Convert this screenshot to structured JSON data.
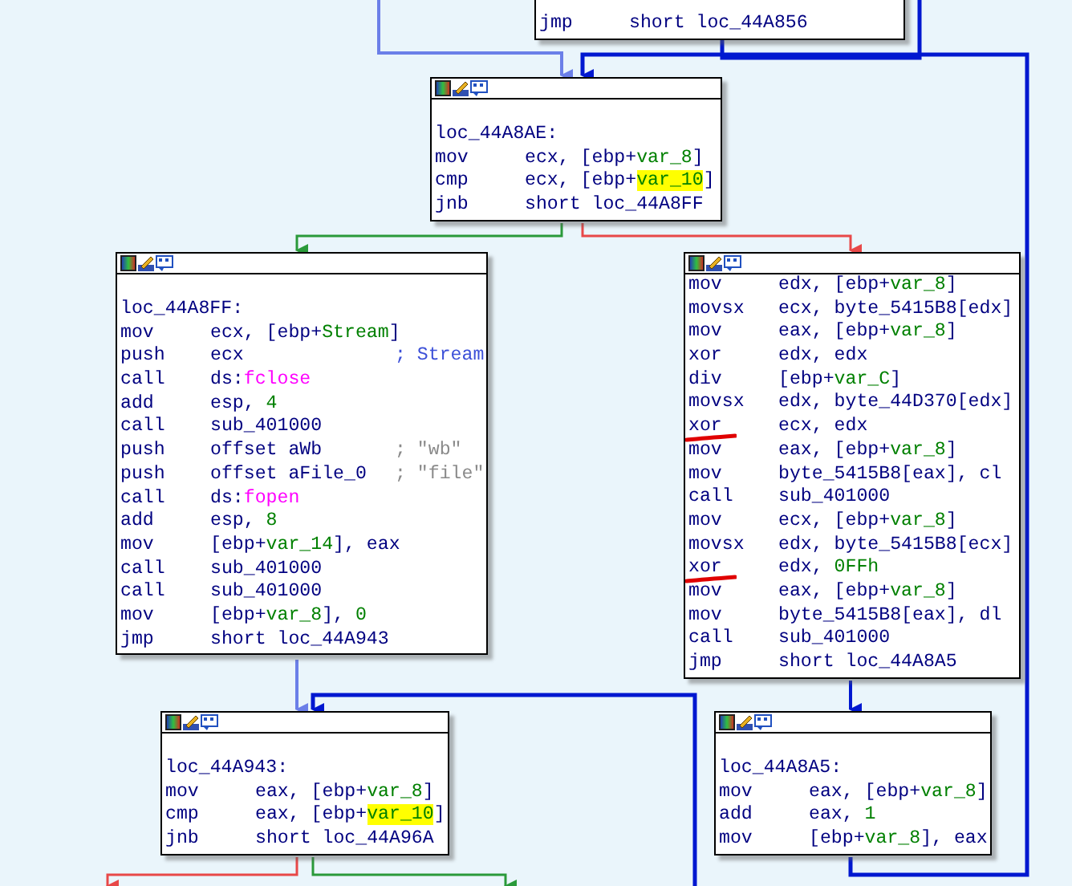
{
  "nodes": [
    {
      "header": false,
      "lines": [
        {
          "kind": "instr",
          "mnemonic": "jmp",
          "operands": [
            {
              "text": "short loc_44A856",
              "kind": "plain"
            }
          ]
        }
      ]
    },
    {
      "header": true,
      "lines": [
        {
          "kind": "label",
          "text": "loc_44A8AE:"
        },
        {
          "kind": "instr",
          "mnemonic": "mov",
          "operands": [
            {
              "text": "ecx, [ebp+",
              "kind": "plain"
            },
            {
              "text": "var_8",
              "kind": "name"
            },
            {
              "text": "]",
              "kind": "plain"
            }
          ]
        },
        {
          "kind": "instr",
          "mnemonic": "cmp",
          "operands": [
            {
              "text": "ecx, [ebp+",
              "kind": "plain"
            },
            {
              "text": "var_10",
              "kind": "highlight"
            },
            {
              "text": "]",
              "kind": "plain"
            }
          ]
        },
        {
          "kind": "instr",
          "mnemonic": "jnb",
          "operands": [
            {
              "text": "short loc_44A8FF",
              "kind": "plain"
            }
          ]
        }
      ]
    },
    {
      "header": true,
      "lines": [
        {
          "kind": "label",
          "text": "loc_44A8FF:"
        },
        {
          "kind": "instr",
          "mnemonic": "mov",
          "operands": [
            {
              "text": "ecx, [ebp+",
              "kind": "plain"
            },
            {
              "text": "Stream",
              "kind": "name"
            },
            {
              "text": "]",
              "kind": "plain"
            }
          ]
        },
        {
          "kind": "instr",
          "mnemonic": "push",
          "operands": [
            {
              "text": "ecx",
              "kind": "plain"
            }
          ],
          "comment": {
            "text": "; Stream",
            "kind": "name"
          }
        },
        {
          "kind": "instr",
          "mnemonic": "call",
          "operands": [
            {
              "text": "ds:",
              "kind": "plain"
            },
            {
              "text": "fclose",
              "kind": "import"
            }
          ]
        },
        {
          "kind": "instr",
          "mnemonic": "add",
          "operands": [
            {
              "text": "esp, ",
              "kind": "plain"
            },
            {
              "text": "4",
              "kind": "number"
            }
          ]
        },
        {
          "kind": "instr",
          "mnemonic": "call",
          "operands": [
            {
              "text": "sub_401000",
              "kind": "plain"
            }
          ]
        },
        {
          "kind": "instr",
          "mnemonic": "push",
          "operands": [
            {
              "text": "offset aWb",
              "kind": "plain"
            }
          ],
          "comment": {
            "text": "; \"wb\"",
            "kind": "string"
          }
        },
        {
          "kind": "instr",
          "mnemonic": "push",
          "operands": [
            {
              "text": "offset aFile_0",
              "kind": "plain"
            }
          ],
          "comment": {
            "text": "; \"file\"",
            "kind": "string"
          }
        },
        {
          "kind": "instr",
          "mnemonic": "call",
          "operands": [
            {
              "text": "ds:",
              "kind": "plain"
            },
            {
              "text": "fopen",
              "kind": "import"
            }
          ]
        },
        {
          "kind": "instr",
          "mnemonic": "add",
          "operands": [
            {
              "text": "esp, ",
              "kind": "plain"
            },
            {
              "text": "8",
              "kind": "number"
            }
          ]
        },
        {
          "kind": "instr",
          "mnemonic": "mov",
          "operands": [
            {
              "text": "[ebp+",
              "kind": "plain"
            },
            {
              "text": "var_14",
              "kind": "name"
            },
            {
              "text": "], eax",
              "kind": "plain"
            }
          ]
        },
        {
          "kind": "instr",
          "mnemonic": "call",
          "operands": [
            {
              "text": "sub_401000",
              "kind": "plain"
            }
          ]
        },
        {
          "kind": "instr",
          "mnemonic": "call",
          "operands": [
            {
              "text": "sub_401000",
              "kind": "plain"
            }
          ]
        },
        {
          "kind": "instr",
          "mnemonic": "mov",
          "operands": [
            {
              "text": "[ebp+",
              "kind": "plain"
            },
            {
              "text": "var_8",
              "kind": "name"
            },
            {
              "text": "], ",
              "kind": "plain"
            },
            {
              "text": "0",
              "kind": "number"
            }
          ]
        },
        {
          "kind": "instr",
          "mnemonic": "jmp",
          "operands": [
            {
              "text": "short loc_44A943",
              "kind": "plain"
            }
          ]
        }
      ]
    },
    {
      "header": true,
      "lines": [
        {
          "kind": "instr",
          "mnemonic": "mov",
          "operands": [
            {
              "text": "edx, [ebp+",
              "kind": "plain"
            },
            {
              "text": "var_8",
              "kind": "name"
            },
            {
              "text": "]",
              "kind": "plain"
            }
          ]
        },
        {
          "kind": "instr",
          "mnemonic": "movsx",
          "operands": [
            {
              "text": "ecx, byte_5415B8[edx]",
              "kind": "plain"
            }
          ]
        },
        {
          "kind": "instr",
          "mnemonic": "mov",
          "operands": [
            {
              "text": "eax, [ebp+",
              "kind": "plain"
            },
            {
              "text": "var_8",
              "kind": "name"
            },
            {
              "text": "]",
              "kind": "plain"
            }
          ]
        },
        {
          "kind": "instr",
          "mnemonic": "xor",
          "operands": [
            {
              "text": "edx, edx",
              "kind": "plain"
            }
          ]
        },
        {
          "kind": "instr",
          "mnemonic": "div",
          "operands": [
            {
              "text": "[ebp+",
              "kind": "plain"
            },
            {
              "text": "var_C",
              "kind": "name"
            },
            {
              "text": "]",
              "kind": "plain"
            }
          ]
        },
        {
          "kind": "instr",
          "mnemonic": "movsx",
          "operands": [
            {
              "text": "edx, byte_44D370[edx]",
              "kind": "plain"
            }
          ]
        },
        {
          "kind": "instr",
          "mnemonic": "xor",
          "marked": true,
          "operands": [
            {
              "text": "ecx, edx",
              "kind": "plain"
            }
          ]
        },
        {
          "kind": "instr",
          "mnemonic": "mov",
          "operands": [
            {
              "text": "eax, [ebp+",
              "kind": "plain"
            },
            {
              "text": "var_8",
              "kind": "name"
            },
            {
              "text": "]",
              "kind": "plain"
            }
          ]
        },
        {
          "kind": "instr",
          "mnemonic": "mov",
          "operands": [
            {
              "text": "byte_5415B8[eax], cl",
              "kind": "plain"
            }
          ]
        },
        {
          "kind": "instr",
          "mnemonic": "call",
          "operands": [
            {
              "text": "sub_401000",
              "kind": "plain"
            }
          ]
        },
        {
          "kind": "instr",
          "mnemonic": "mov",
          "operands": [
            {
              "text": "ecx, [ebp+",
              "kind": "plain"
            },
            {
              "text": "var_8",
              "kind": "name"
            },
            {
              "text": "]",
              "kind": "plain"
            }
          ]
        },
        {
          "kind": "instr",
          "mnemonic": "movsx",
          "operands": [
            {
              "text": "edx, byte_5415B8[ecx]",
              "kind": "plain"
            }
          ]
        },
        {
          "kind": "instr",
          "mnemonic": "xor",
          "marked": true,
          "operands": [
            {
              "text": "edx, ",
              "kind": "plain"
            },
            {
              "text": "0FFh",
              "kind": "number"
            }
          ]
        },
        {
          "kind": "instr",
          "mnemonic": "mov",
          "operands": [
            {
              "text": "eax, [ebp+",
              "kind": "plain"
            },
            {
              "text": "var_8",
              "kind": "name"
            },
            {
              "text": "]",
              "kind": "plain"
            }
          ]
        },
        {
          "kind": "instr",
          "mnemonic": "mov",
          "operands": [
            {
              "text": "byte_5415B8[eax], dl",
              "kind": "plain"
            }
          ]
        },
        {
          "kind": "instr",
          "mnemonic": "call",
          "operands": [
            {
              "text": "sub_401000",
              "kind": "plain"
            }
          ]
        },
        {
          "kind": "instr",
          "mnemonic": "jmp",
          "operands": [
            {
              "text": "short loc_44A8A5",
              "kind": "plain"
            }
          ]
        }
      ]
    },
    {
      "header": true,
      "lines": [
        {
          "kind": "label",
          "text": "loc_44A943:"
        },
        {
          "kind": "instr",
          "mnemonic": "mov",
          "operands": [
            {
              "text": "eax, [ebp+",
              "kind": "plain"
            },
            {
              "text": "var_8",
              "kind": "name"
            },
            {
              "text": "]",
              "kind": "plain"
            }
          ]
        },
        {
          "kind": "instr",
          "mnemonic": "cmp",
          "operands": [
            {
              "text": "eax, [ebp+",
              "kind": "plain"
            },
            {
              "text": "var_10",
              "kind": "highlight"
            },
            {
              "text": "]",
              "kind": "plain"
            }
          ]
        },
        {
          "kind": "instr",
          "mnemonic": "jnb",
          "operands": [
            {
              "text": "short loc_44A96A",
              "kind": "plain"
            }
          ]
        }
      ]
    },
    {
      "header": true,
      "lines": [
        {
          "kind": "label",
          "text": "loc_44A8A5:"
        },
        {
          "kind": "instr",
          "mnemonic": "mov",
          "operands": [
            {
              "text": "eax, [ebp+",
              "kind": "plain"
            },
            {
              "text": "var_8",
              "kind": "name"
            },
            {
              "text": "]",
              "kind": "plain"
            }
          ]
        },
        {
          "kind": "instr",
          "mnemonic": "add",
          "operands": [
            {
              "text": "eax, ",
              "kind": "plain"
            },
            {
              "text": "1",
              "kind": "number"
            }
          ]
        },
        {
          "kind": "instr",
          "mnemonic": "mov",
          "operands": [
            {
              "text": "[ebp+",
              "kind": "plain"
            },
            {
              "text": "var_8",
              "kind": "name"
            },
            {
              "text": "], eax",
              "kind": "plain"
            }
          ]
        }
      ]
    }
  ]
}
